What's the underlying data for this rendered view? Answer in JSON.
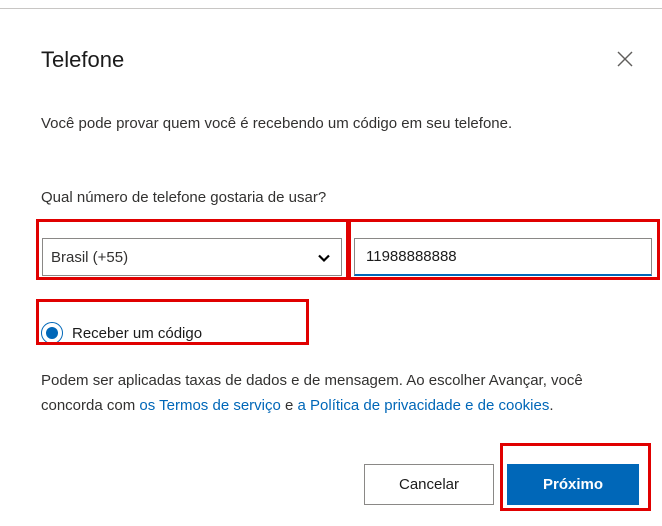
{
  "dialog": {
    "title": "Telefone",
    "description": "Você pode provar quem você é recebendo um código em seu telefone.",
    "question": "Qual número de telefone gostaria de usar?"
  },
  "country_select": {
    "selected": "Brasil (+55)"
  },
  "phone_input": {
    "value": "11988888888"
  },
  "method": {
    "label": "Receber um código",
    "selected": true
  },
  "disclaimer": {
    "text_before": "Podem ser aplicadas taxas de dados e de mensagem. Ao escolher Avançar, você concorda com ",
    "terms_link": "os Termos de serviço",
    "text_middle": " e ",
    "privacy_link": "a Política de privacidade e de cookies",
    "text_after": "."
  },
  "buttons": {
    "cancel": "Cancelar",
    "next": "Próximo"
  },
  "colors": {
    "accent": "#0067b8",
    "highlight": "#e00000",
    "text": "#323130"
  }
}
